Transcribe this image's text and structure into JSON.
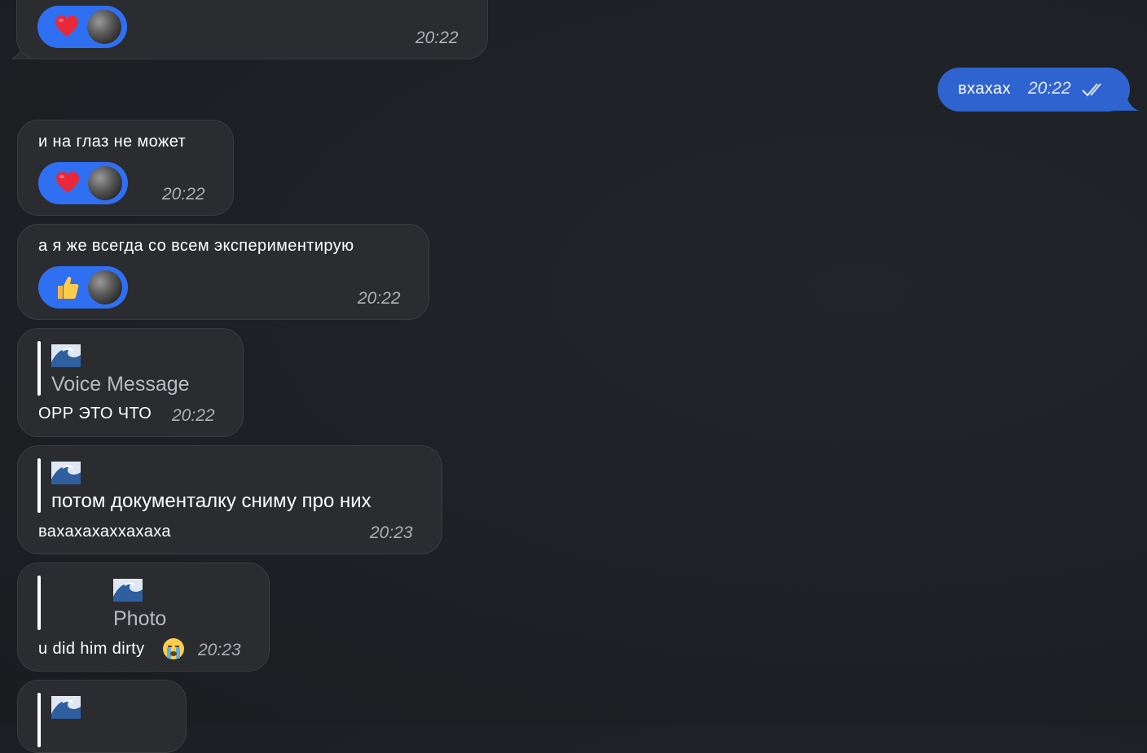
{
  "colors": {
    "incoming_bubble": "#2b2c2f",
    "outgoing_bubble": "#2f63cf",
    "reaction_pill": "#2f6ff2",
    "timestamp": "#aeb0b5"
  },
  "messages": [
    {
      "direction": "incoming",
      "text": "",
      "time": "20:22",
      "reaction": {
        "emoji": "heart-emoji"
      }
    },
    {
      "direction": "outgoing",
      "text": "вхахах",
      "time": "20:22",
      "status": "read-double-check"
    },
    {
      "direction": "incoming",
      "text": "и на глаз не может",
      "time": "20:22",
      "reaction": {
        "emoji": "heart-emoji"
      }
    },
    {
      "direction": "incoming",
      "text": "а я же всегда со всем экспериментирую",
      "time": "20:22",
      "reaction": {
        "emoji": "thumbs-up-emoji"
      }
    },
    {
      "direction": "incoming",
      "reply": {
        "sender_icon": "wave-emoji",
        "title": "Voice Message"
      },
      "text": "ОРР ЭТО ЧТО",
      "time": "20:22"
    },
    {
      "direction": "incoming",
      "reply": {
        "sender_icon": "wave-emoji",
        "title": "потом документалку сниму про них"
      },
      "text": "вахахахаххахаха",
      "time": "20:23"
    },
    {
      "direction": "incoming",
      "reply": {
        "sender_icon": "wave-emoji",
        "title": "Photo"
      },
      "text": "u did him dirty",
      "trailing_emoji": "loudly-crying-emoji",
      "time": "20:23"
    },
    {
      "direction": "incoming",
      "reply": {
        "sender_icon": "wave-emoji",
        "title": ""
      },
      "text": "",
      "time": ""
    }
  ]
}
